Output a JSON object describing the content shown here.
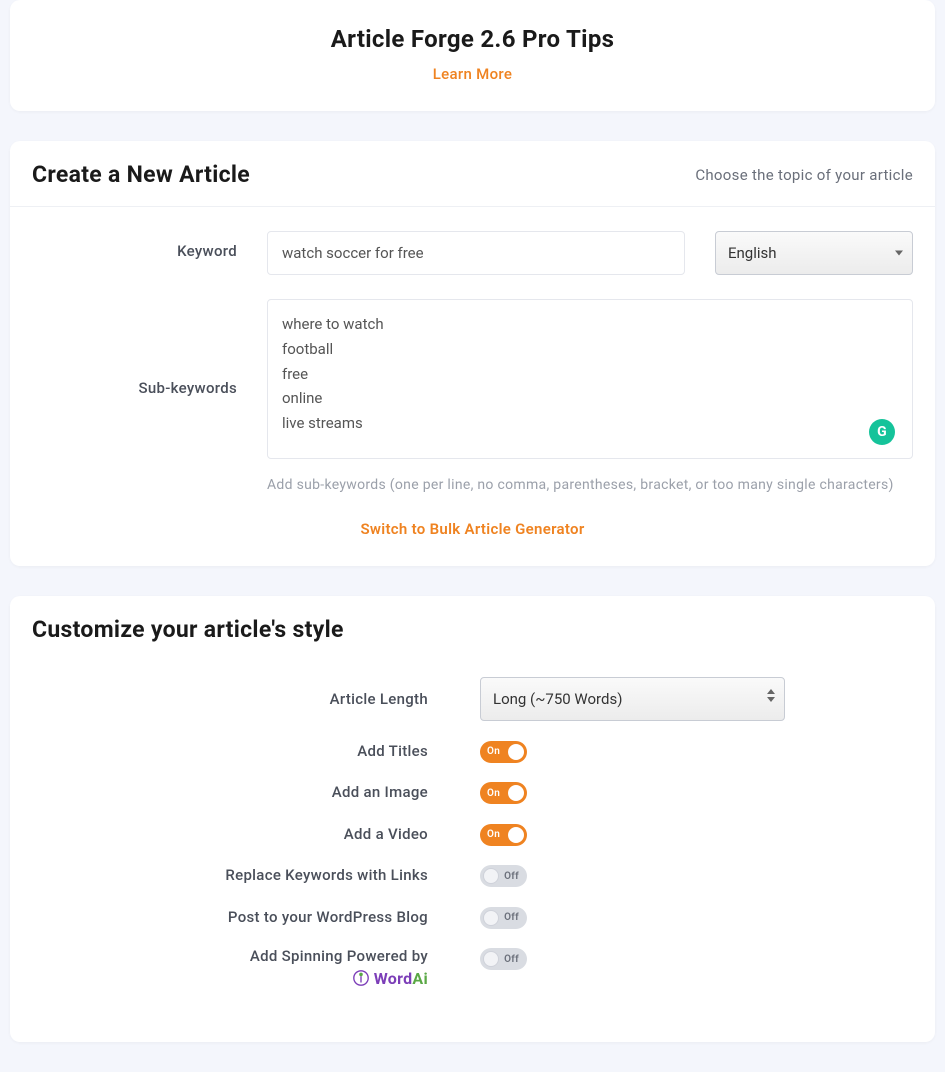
{
  "tips": {
    "title": "Article Forge 2.6 Pro Tips",
    "learn_more": "Learn More"
  },
  "create": {
    "title": "Create a New Article",
    "subtitle": "Choose the topic of your article",
    "keyword_label": "Keyword",
    "keyword_value": "watch soccer for free",
    "language_selected": "English",
    "subkeywords_label": "Sub-keywords",
    "subkeywords_value": "where to watch\nfootball\nfree\nonline\nlive streams",
    "subkeywords_helper": "Add sub-keywords (one per line, no comma, parentheses, bracket, or too many single characters)",
    "bulk_link": "Switch to Bulk Article Generator",
    "grammarly": "G"
  },
  "style": {
    "title": "Customize your article's style",
    "length_label": "Article Length",
    "length_selected": "Long (~750 Words)",
    "rows": {
      "titles": {
        "label": "Add Titles",
        "state": "On"
      },
      "image": {
        "label": "Add an Image",
        "state": "On"
      },
      "video": {
        "label": "Add a Video",
        "state": "On"
      },
      "links": {
        "label": "Replace Keywords with Links",
        "state": "Off"
      },
      "wordpress": {
        "label": "Post to your WordPress Blog",
        "state": "Off"
      },
      "spinning": {
        "label": "Add Spinning Powered by",
        "state": "Off"
      }
    },
    "wordai": {
      "word": "Word",
      "ai": "Ai"
    }
  }
}
